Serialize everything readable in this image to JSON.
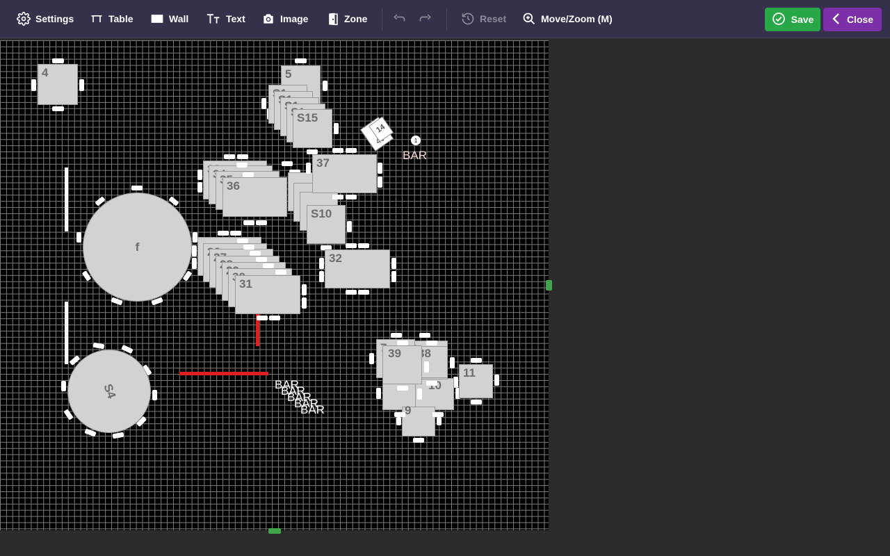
{
  "toolbar": {
    "settings": "Settings",
    "table": "Table",
    "wall": "Wall",
    "text": "Text",
    "image": "Image",
    "zone": "Zone",
    "reset": "Reset",
    "move_zoom": "Move/Zoom (M)",
    "save": "Save",
    "close": "Close"
  },
  "canvas": {
    "tables": {
      "t4": "4",
      "t5": "5",
      "s15": "S15",
      "s1a": "S1",
      "s1b": "S1",
      "s1c": "S1",
      "s1d": "S1",
      "t33": "33",
      "t34": "34",
      "t35": "35",
      "t36": "36",
      "t37": "37",
      "s10": "S10",
      "t26": "26",
      "t27": "27",
      "t28": "28",
      "t29": "29",
      "t30": "30",
      "t31": "31",
      "t32": "32",
      "t7": "7",
      "t8": "8",
      "t39": "39",
      "t38": "38",
      "t10": "10",
      "t9": "9",
      "t11": "11",
      "t40": "40",
      "t14": "14"
    },
    "round_tables": {
      "f": "f",
      "s4": "S4"
    },
    "labels": {
      "bar_main": "BAR",
      "bar_marker": "1",
      "bar_stack": [
        "BAR",
        "BAR",
        "BAR",
        "BAR",
        "BAR"
      ]
    }
  },
  "colors": {
    "toolbar_bg": "#35314b",
    "save": "#27a745",
    "close": "#7b2fa8",
    "wall_red": "#e0201e",
    "table_fill": "#d2d2d2"
  }
}
